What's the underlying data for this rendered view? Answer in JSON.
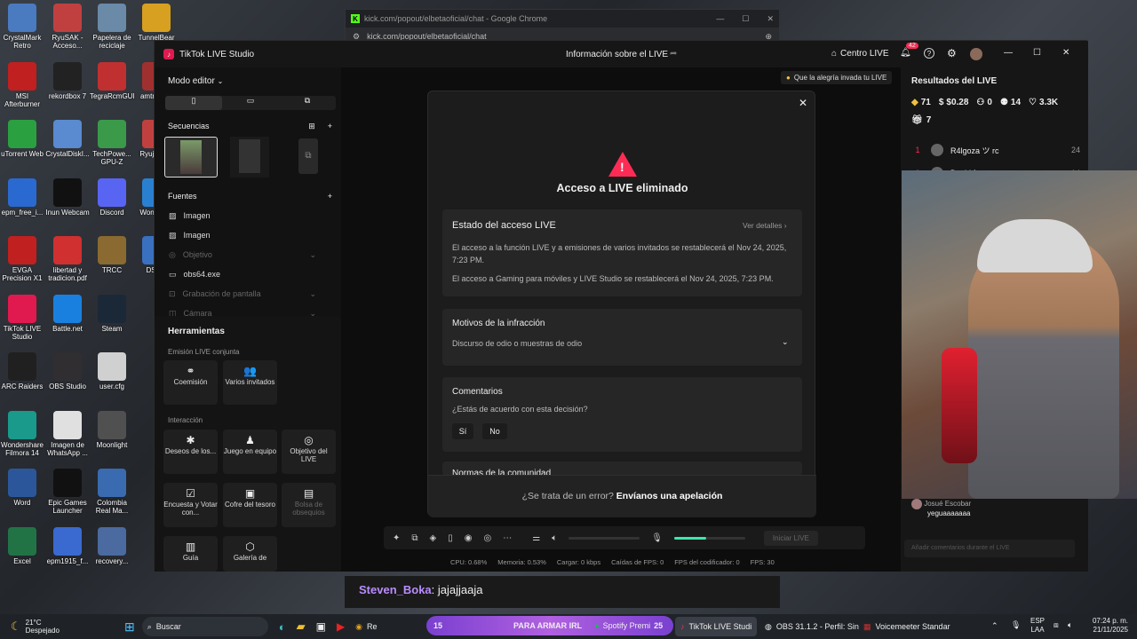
{
  "desktop_icons": [
    {
      "label": "CrystalMark Retro",
      "icon": "crystalmark-icon",
      "color": "#4a7ac0",
      "col": 0,
      "row": 0
    },
    {
      "label": "RyuSAK - Acceso...",
      "icon": "ryusak-icon",
      "color": "#c04040",
      "col": 1,
      "row": 0
    },
    {
      "label": "Papelera de reciclaje",
      "icon": "recycle-bin-icon",
      "color": "#6a8aa8",
      "col": 2,
      "row": 0
    },
    {
      "label": "TunnelBear",
      "icon": "tunnelbear-icon",
      "color": "#d8a020",
      "col": 3,
      "row": 0
    },
    {
      "label": "MSI Afterburner",
      "icon": "msi-afterburner-icon",
      "color": "#c02020",
      "col": 0,
      "row": 1
    },
    {
      "label": "rekordbox 7",
      "icon": "rekordbox-icon",
      "color": "#222222",
      "col": 1,
      "row": 1
    },
    {
      "label": "TegraRcmGUI",
      "icon": "tegrarcm-icon",
      "color": "#c03030",
      "col": 2,
      "row": 1
    },
    {
      "label": "amtr - Acc",
      "icon": "amtr-icon",
      "color": "#a03030",
      "col": 3,
      "row": 1
    },
    {
      "label": "uTorrent Web",
      "icon": "utorrent-icon",
      "color": "#2aa040",
      "col": 0,
      "row": 2
    },
    {
      "label": "CrystalDiskI...",
      "icon": "crystaldisk-icon",
      "color": "#5a8ad0",
      "col": 1,
      "row": 2
    },
    {
      "label": "TechPowe... GPU-Z",
      "icon": "gpuz-icon",
      "color": "#3a9a4a",
      "col": 2,
      "row": 2
    },
    {
      "label": "Ryuji Acce",
      "icon": "ryujinx-icon",
      "color": "#c04040",
      "col": 3,
      "row": 2
    },
    {
      "label": "epm_free_i...",
      "icon": "epm-icon",
      "color": "#2a6ad0",
      "col": 0,
      "row": 3
    },
    {
      "label": "Inun Webcam",
      "icon": "webcam-icon",
      "color": "#111111",
      "col": 1,
      "row": 3
    },
    {
      "label": "Discord",
      "icon": "discord-icon",
      "color": "#5865f2",
      "col": 2,
      "row": 3
    },
    {
      "label": "Wond Rec",
      "icon": "wondershare-rec-icon",
      "color": "#2a80d0",
      "col": 3,
      "row": 3
    },
    {
      "label": "EVGA Precision X1",
      "icon": "evga-icon",
      "color": "#c02020",
      "col": 0,
      "row": 4
    },
    {
      "label": "libertad y tradicion.pdf",
      "icon": "pdf-icon",
      "color": "#d03030",
      "col": 1,
      "row": 4
    },
    {
      "label": "TRCC",
      "icon": "trcc-icon",
      "color": "#8a6a30",
      "col": 2,
      "row": 4
    },
    {
      "label": "DS4W",
      "icon": "ds4w-icon",
      "color": "#3a70c0",
      "col": 3,
      "row": 4
    },
    {
      "label": "TikTok LIVE Studio",
      "icon": "tiktok-live-icon",
      "color": "#e01a4f",
      "col": 0,
      "row": 5
    },
    {
      "label": "Battle.net",
      "icon": "battlenet-icon",
      "color": "#1a80e0",
      "col": 1,
      "row": 5
    },
    {
      "label": "Steam",
      "icon": "steam-icon",
      "color": "#1b2838",
      "col": 2,
      "row": 5
    },
    {
      "label": "ARC Raiders",
      "icon": "arc-raiders-icon",
      "color": "#202020",
      "col": 0,
      "row": 6
    },
    {
      "label": "OBS Studio",
      "icon": "obs-icon",
      "color": "#302e31",
      "col": 1,
      "row": 6
    },
    {
      "label": "user.cfg",
      "icon": "file-icon",
      "color": "#d0d0d0",
      "col": 2,
      "row": 6
    },
    {
      "label": "Wondershare Filmora 14",
      "icon": "filmora-icon",
      "color": "#1a9a8a",
      "col": 0,
      "row": 7
    },
    {
      "label": "Imagen de WhatsApp ...",
      "icon": "image-file-icon",
      "color": "#e0e0e0",
      "col": 1,
      "row": 7
    },
    {
      "label": "Moonlight",
      "icon": "moonlight-icon",
      "color": "#505050",
      "col": 2,
      "row": 7
    },
    {
      "label": "Word",
      "icon": "word-icon",
      "color": "#2b579a",
      "col": 0,
      "row": 8
    },
    {
      "label": "Epic Games Launcher",
      "icon": "epic-games-icon",
      "color": "#111111",
      "col": 1,
      "row": 8
    },
    {
      "label": "Colombia Real Ma...",
      "icon": "colombia-icon",
      "color": "#3a6ab0",
      "col": 2,
      "row": 8
    },
    {
      "label": "Excel",
      "icon": "excel-icon",
      "color": "#217346",
      "col": 0,
      "row": 9
    },
    {
      "label": "epm1915_f...",
      "icon": "epm-file-icon",
      "color": "#3a6ad0",
      "col": 1,
      "row": 9
    },
    {
      "label": "recovery...",
      "icon": "recovery-icon",
      "color": "#4a6aa0",
      "col": 2,
      "row": 9
    }
  ],
  "chrome": {
    "title": "kick.com/popout/elbetaoficial/chat - Google Chrome",
    "url": "kick.com/popout/elbetaoficial/chat"
  },
  "tiktok": {
    "app_title": "TikTok LIVE Studio",
    "center_title": "Información sobre el LIVE",
    "centro_live": "Centro LIVE",
    "notif_count": "42",
    "editor_mode": "Modo editor",
    "secuencias": "Secuencias",
    "fuentes": "Fuentes",
    "sources": [
      {
        "label": "Imagen",
        "dim": false,
        "icon": "image-icon"
      },
      {
        "label": "Imagen",
        "dim": false,
        "icon": "image-icon"
      },
      {
        "label": "Objetivo",
        "dim": true,
        "icon": "target-icon"
      },
      {
        "label": "obs64.exe",
        "dim": false,
        "icon": "window-icon"
      },
      {
        "label": "Grabación de pantalla",
        "dim": true,
        "icon": "screen-record-icon"
      },
      {
        "label": "Cámara",
        "dim": true,
        "icon": "camera-icon"
      }
    ],
    "herramientas": "Herramientas",
    "emision_conjunta": "Emisión LIVE conjunta",
    "tools_row1": [
      {
        "label": "Coemisión",
        "icon": "link-icon",
        "glyph": "⚭"
      },
      {
        "label": "Varios invitados",
        "icon": "guests-icon",
        "glyph": "👥"
      }
    ],
    "interaccion": "Interacción",
    "tools_row2": [
      {
        "label": "Deseos de los...",
        "icon": "wishes-icon",
        "glyph": "✱",
        "dim": false
      },
      {
        "label": "Juego en equipo",
        "icon": "team-game-icon",
        "glyph": "♟",
        "dim": false
      },
      {
        "label": "Objetivo del LIVE",
        "icon": "goal-icon",
        "glyph": "◎",
        "dim": false
      }
    ],
    "tools_row3": [
      {
        "label": "Encuesta y Votar con...",
        "icon": "poll-icon",
        "glyph": "☑",
        "dim": false
      },
      {
        "label": "Cofre del tesoro",
        "icon": "chest-icon",
        "glyph": "▣",
        "dim": false
      },
      {
        "label": "Bolsa de obsequios",
        "icon": "gift-bag-icon",
        "glyph": "▤",
        "dim": true
      }
    ],
    "tools_row4": [
      {
        "label": "Guía",
        "icon": "guide-icon",
        "glyph": "▥"
      },
      {
        "label": "Galería de",
        "icon": "gallery-icon",
        "glyph": "⬡"
      }
    ],
    "hint": "Que la alegría invada tu LIVE",
    "start_live": "Iniciar LIVE",
    "status": {
      "cpu": "CPU: 0.68%",
      "mem": "Memoria: 0.53%",
      "load": "Cargar: 0 kbps",
      "drops": "Caídas de FPS: 0",
      "encoder": "FPS del codificador: 0",
      "fps": "FPS: 30"
    },
    "mic_level": 0.45,
    "right": {
      "title": "Resultados del LIVE",
      "stats": [
        {
          "icon": "diamond-icon",
          "glyph": "◆",
          "value": "71"
        },
        {
          "icon": "dollar-icon",
          "glyph": "$",
          "value": "$0.28"
        },
        {
          "icon": "viewers-icon",
          "glyph": "⚇",
          "value": "0"
        },
        {
          "icon": "followers-icon",
          "glyph": "⚉",
          "value": "14"
        },
        {
          "icon": "heart-icon",
          "glyph": "♡",
          "value": "3.3K"
        }
      ],
      "gifts": "7",
      "ranking": [
        {
          "rank": "1",
          "name": "R4lgoza ツ rc",
          "score": "24"
        },
        {
          "rank": "2",
          "name": "David franco",
          "score": "14"
        }
      ],
      "chat_user": "Josué Escobar",
      "chat_msg": "yeguaaaaaaa",
      "comment_placeholder": "Añadir comentarios durante el LIVE"
    }
  },
  "dialog": {
    "title": "Acceso a LIVE eliminado",
    "status_title": "Estado del acceso LIVE",
    "details_link": "Ver detalles",
    "status_text1": "El acceso a la función LIVE y a emisiones de varios invitados se restablecerá el Nov 24, 2025, 7:23 PM.",
    "status_text2": "El acceso a Gaming para móviles y LIVE Studio se restablecerá el Nov 24, 2025, 7:23 PM.",
    "reasons_title": "Motivos de la infracción",
    "reason": "Discurso de odio o muestras de odio",
    "comments_title": "Comentarios",
    "question": "¿Estás de acuerdo con esta decisión?",
    "yes": "Sí",
    "no": "No",
    "community": "Normas de la comunidad",
    "error_text": "¿Se trata de un error?",
    "appeal": "Envíanos una apelación"
  },
  "kick_chat": {
    "user": "Steven_Boka",
    "message": ": jajajjaaja",
    "user_color": "#b98cff"
  },
  "taskbar": {
    "weather_temp": "21°C",
    "weather_desc": "Despejado",
    "search_placeholder": "Buscar",
    "rec_label": "Re",
    "pill_left": "15",
    "pill_center": "PARA ARMAR IRL",
    "pill_right": "25",
    "spotify": "Spotify Premi",
    "tiktok": "TikTok LIVE Studi",
    "obs": "OBS 31.1.2 - Perfil: Sin",
    "voicemeeter": "Voicemeeter Standar",
    "lang1": "ESP",
    "lang2": "LAA",
    "time": "07:24 p. m.",
    "date": "21/11/2025"
  }
}
